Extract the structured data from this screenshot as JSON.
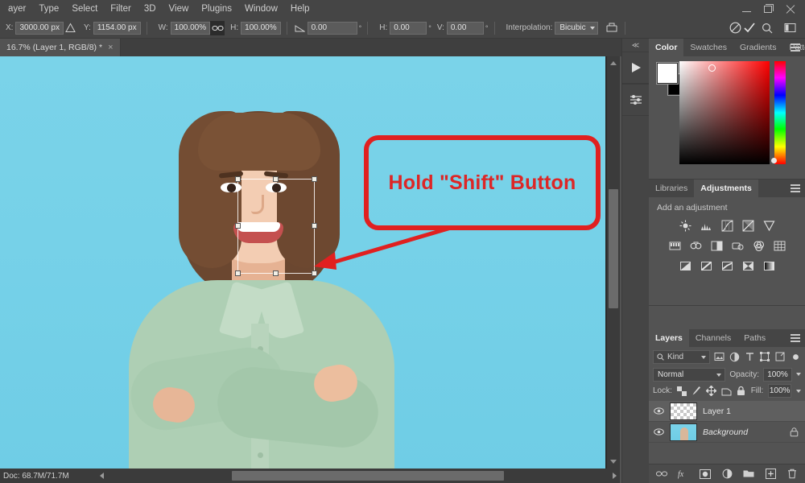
{
  "menubar": {
    "items": [
      {
        "label": "ayer"
      },
      {
        "label": "Type"
      },
      {
        "label": "Select"
      },
      {
        "label": "Filter"
      },
      {
        "label": "3D"
      },
      {
        "label": "View"
      },
      {
        "label": "Plugins"
      },
      {
        "label": "Window"
      },
      {
        "label": "Help"
      }
    ],
    "window_controls": [
      "minimize",
      "maximize",
      "close"
    ]
  },
  "options_bar": {
    "x_label": "X:",
    "x_value": "3000.00 px",
    "y_label": "Y:",
    "y_value": "1154.00 px",
    "w_label": "W:",
    "w_value": "100.00%",
    "h_label": "H:",
    "h_value": "100.00%",
    "angle_value": "0.00",
    "skew_h_label": "H:",
    "skew_h_value": "0.00",
    "skew_v_label": "V:",
    "skew_v_value": "0.00",
    "interpolation_label": "Interpolation:",
    "interpolation_value": "Bicubic",
    "degree_symbol": "°",
    "icons": {
      "reference_point": "reference-point-icon",
      "link": "link-chain-icon",
      "warp": "warp-icon",
      "cancel": "cancel-transform-icon",
      "commit": "commit-transform-icon",
      "search": "search-icon",
      "workspace": "workspace-icon"
    }
  },
  "document_tab": {
    "title": "16.7% (Layer 1, RGB/8) *",
    "close_glyph": "×"
  },
  "canvas": {
    "background_color": "#76d1e8",
    "callout": {
      "text": "Hold \"Shift\" Button",
      "border_color": "#e02020",
      "text_color": "#dd2626"
    },
    "transform_box": {
      "handles": [
        "top-left",
        "top-center",
        "top-right",
        "middle-left",
        "middle-right",
        "bottom-left",
        "bottom-center",
        "bottom-right"
      ]
    }
  },
  "status_bar": {
    "doc_text": "Doc: 68.7M/71.7M"
  },
  "icon_dock": {
    "collapse_glyph": "≪",
    "items": [
      {
        "name": "actions-play-icon"
      },
      {
        "name": "properties-sliders-icon"
      }
    ]
  },
  "color_panel": {
    "tabs": [
      {
        "label": "Color",
        "active": true
      },
      {
        "label": "Swatches",
        "active": false
      },
      {
        "label": "Gradients",
        "active": false
      },
      {
        "label": "Patterns",
        "active": false
      }
    ],
    "foreground_color": "#ffffff",
    "background_color": "#000000"
  },
  "adjustments_panel": {
    "tabs": [
      {
        "label": "Libraries",
        "active": false
      },
      {
        "label": "Adjustments",
        "active": true
      }
    ],
    "heading": "Add an adjustment",
    "icon_rows": [
      [
        "brightness-contrast-icon",
        "levels-icon",
        "curves-icon",
        "exposure-icon",
        "vibrance-icon"
      ],
      [
        "hue-saturation-icon",
        "color-balance-icon",
        "black-white-icon",
        "photo-filter-icon",
        "channel-mixer-icon",
        "color-lookup-icon"
      ],
      [
        "invert-icon",
        "posterize-icon",
        "threshold-icon",
        "selective-color-icon",
        "gradient-map-icon"
      ]
    ]
  },
  "layers_panel": {
    "tabs": [
      {
        "label": "Layers",
        "active": true
      },
      {
        "label": "Channels",
        "active": false
      },
      {
        "label": "Paths",
        "active": false
      }
    ],
    "filter": {
      "kind_label": "Kind",
      "icons": [
        "filter-pixel-icon",
        "filter-adjustment-icon",
        "filter-type-icon",
        "filter-shape-icon",
        "filter-smart-icon",
        "filter-toggle-icon"
      ]
    },
    "blend_mode": "Normal",
    "opacity_label": "Opacity:",
    "opacity_value": "100%",
    "lock_label": "Lock:",
    "lock_icons": [
      "lock-transparency-icon",
      "lock-image-icon",
      "lock-position-icon",
      "lock-artboard-icon",
      "lock-all-icon"
    ],
    "fill_label": "Fill:",
    "fill_value": "100%",
    "layers": [
      {
        "name": "Layer 1",
        "visible": true,
        "locked": false,
        "selected": true,
        "thumb": "transparent"
      },
      {
        "name": "Background",
        "visible": true,
        "locked": true,
        "selected": false,
        "thumb": "photo"
      }
    ],
    "footer_icons": [
      "link-layers-icon",
      "layer-style-fx-icon",
      "add-mask-icon",
      "new-adjustment-icon",
      "new-group-icon",
      "new-layer-icon",
      "delete-layer-icon"
    ]
  }
}
